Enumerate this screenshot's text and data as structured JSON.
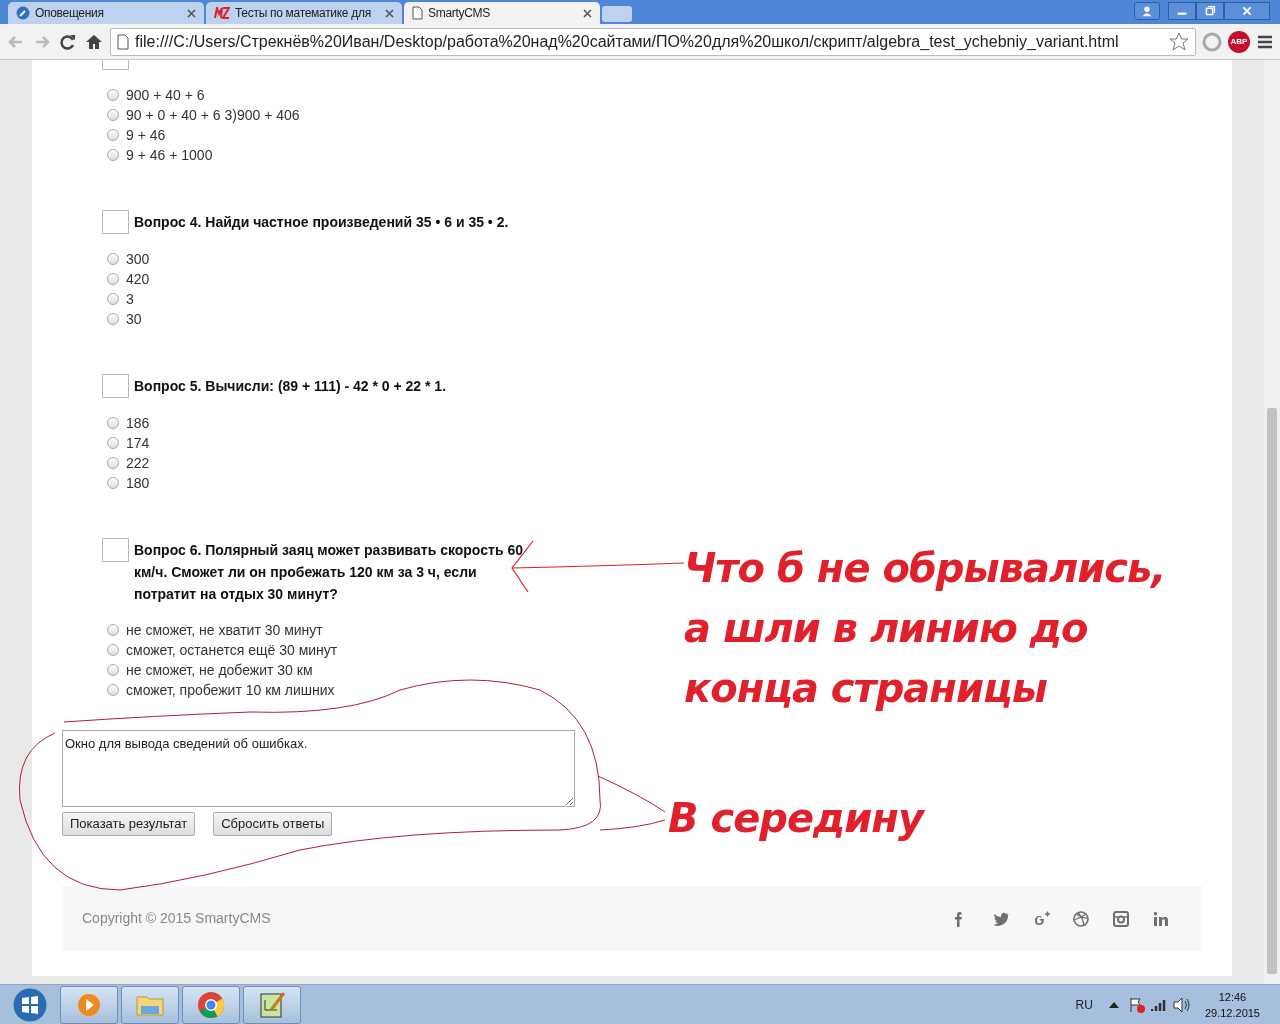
{
  "browser": {
    "tabs": [
      {
        "kind": "gear",
        "label": "Оповещения",
        "selected": false
      },
      {
        "kind": "mz",
        "label": "Тесты по математике для",
        "selected": false
      },
      {
        "kind": "page",
        "label": "SmartyCMS",
        "selected": true
      }
    ],
    "url": "file:///C:/Users/Стрекнёв%20Иван/Desktop/работа%20над%20сайтами/ПО%20для%20школ/скрипт/algebra_test_ychebniy_variant.html",
    "adblock_badge": "ABP"
  },
  "questions": [
    {
      "options": [
        {
          "label": "900 + 40 + 6",
          "selected": false
        },
        {
          "label": "90 + 0 + 40 + 6 3)900 + 406",
          "selected": false
        },
        {
          "label": "9 + 46",
          "selected": false
        },
        {
          "label": "9 + 46 + 1000",
          "selected": false
        }
      ]
    },
    {
      "title": "Вопрос 4. Найди частное произведений 35 • 6 и 35 • 2.",
      "options": [
        {
          "label": "300",
          "selected": false
        },
        {
          "label": "420",
          "selected": false
        },
        {
          "label": "3",
          "selected": false
        },
        {
          "label": "30",
          "selected": false
        }
      ]
    },
    {
      "title": "Вопрос 5. Вычисли: (89 + 111) - 42 * 0 + 22 * 1.",
      "options": [
        {
          "label": "186",
          "selected": false
        },
        {
          "label": "174",
          "selected": false
        },
        {
          "label": "222",
          "selected": false
        },
        {
          "label": "180",
          "selected": false
        }
      ]
    },
    {
      "title": "Вопрос 6. Полярный заяц может развивать скорость 60 км/ч. Сможет ли он пробежать 120 км за 3 ч, если потратит на отдых 30 минут?",
      "options": [
        {
          "label": "не сможет, не хватит 30 минут",
          "selected": false
        },
        {
          "label": "сможет, останется ещё 30 минут",
          "selected": false
        },
        {
          "label": "не сможет, не добежит 30 км",
          "selected": false
        },
        {
          "label": "сможет, пробежит 10 км лишних",
          "selected": false
        }
      ]
    }
  ],
  "error_box": {
    "value": "Окно для вывода сведений об ошибках."
  },
  "buttons": [
    "Показать результат",
    "Сбросить ответы"
  ],
  "footer": {
    "copyright": "Copyright © 2015 SmartyCMS",
    "social": [
      {
        "kind": "facebook"
      },
      {
        "kind": "twitter"
      },
      {
        "kind": "googleplus"
      },
      {
        "kind": "dribbble"
      },
      {
        "kind": "instagram"
      },
      {
        "kind": "linkedin"
      }
    ]
  },
  "annotations": [
    {
      "kind": "arrow-note",
      "text": "Что б не обрывались,\nа шли в линию до\nконца страницы"
    },
    {
      "kind": "loop-note",
      "text": "В середину"
    }
  ],
  "taskbar": {
    "apps": [
      {
        "kind": "media"
      },
      {
        "kind": "explorer"
      },
      {
        "kind": "chrome"
      },
      {
        "kind": "notepad"
      }
    ],
    "language": "RU",
    "time": "12:46",
    "date": "29.12.2015"
  }
}
